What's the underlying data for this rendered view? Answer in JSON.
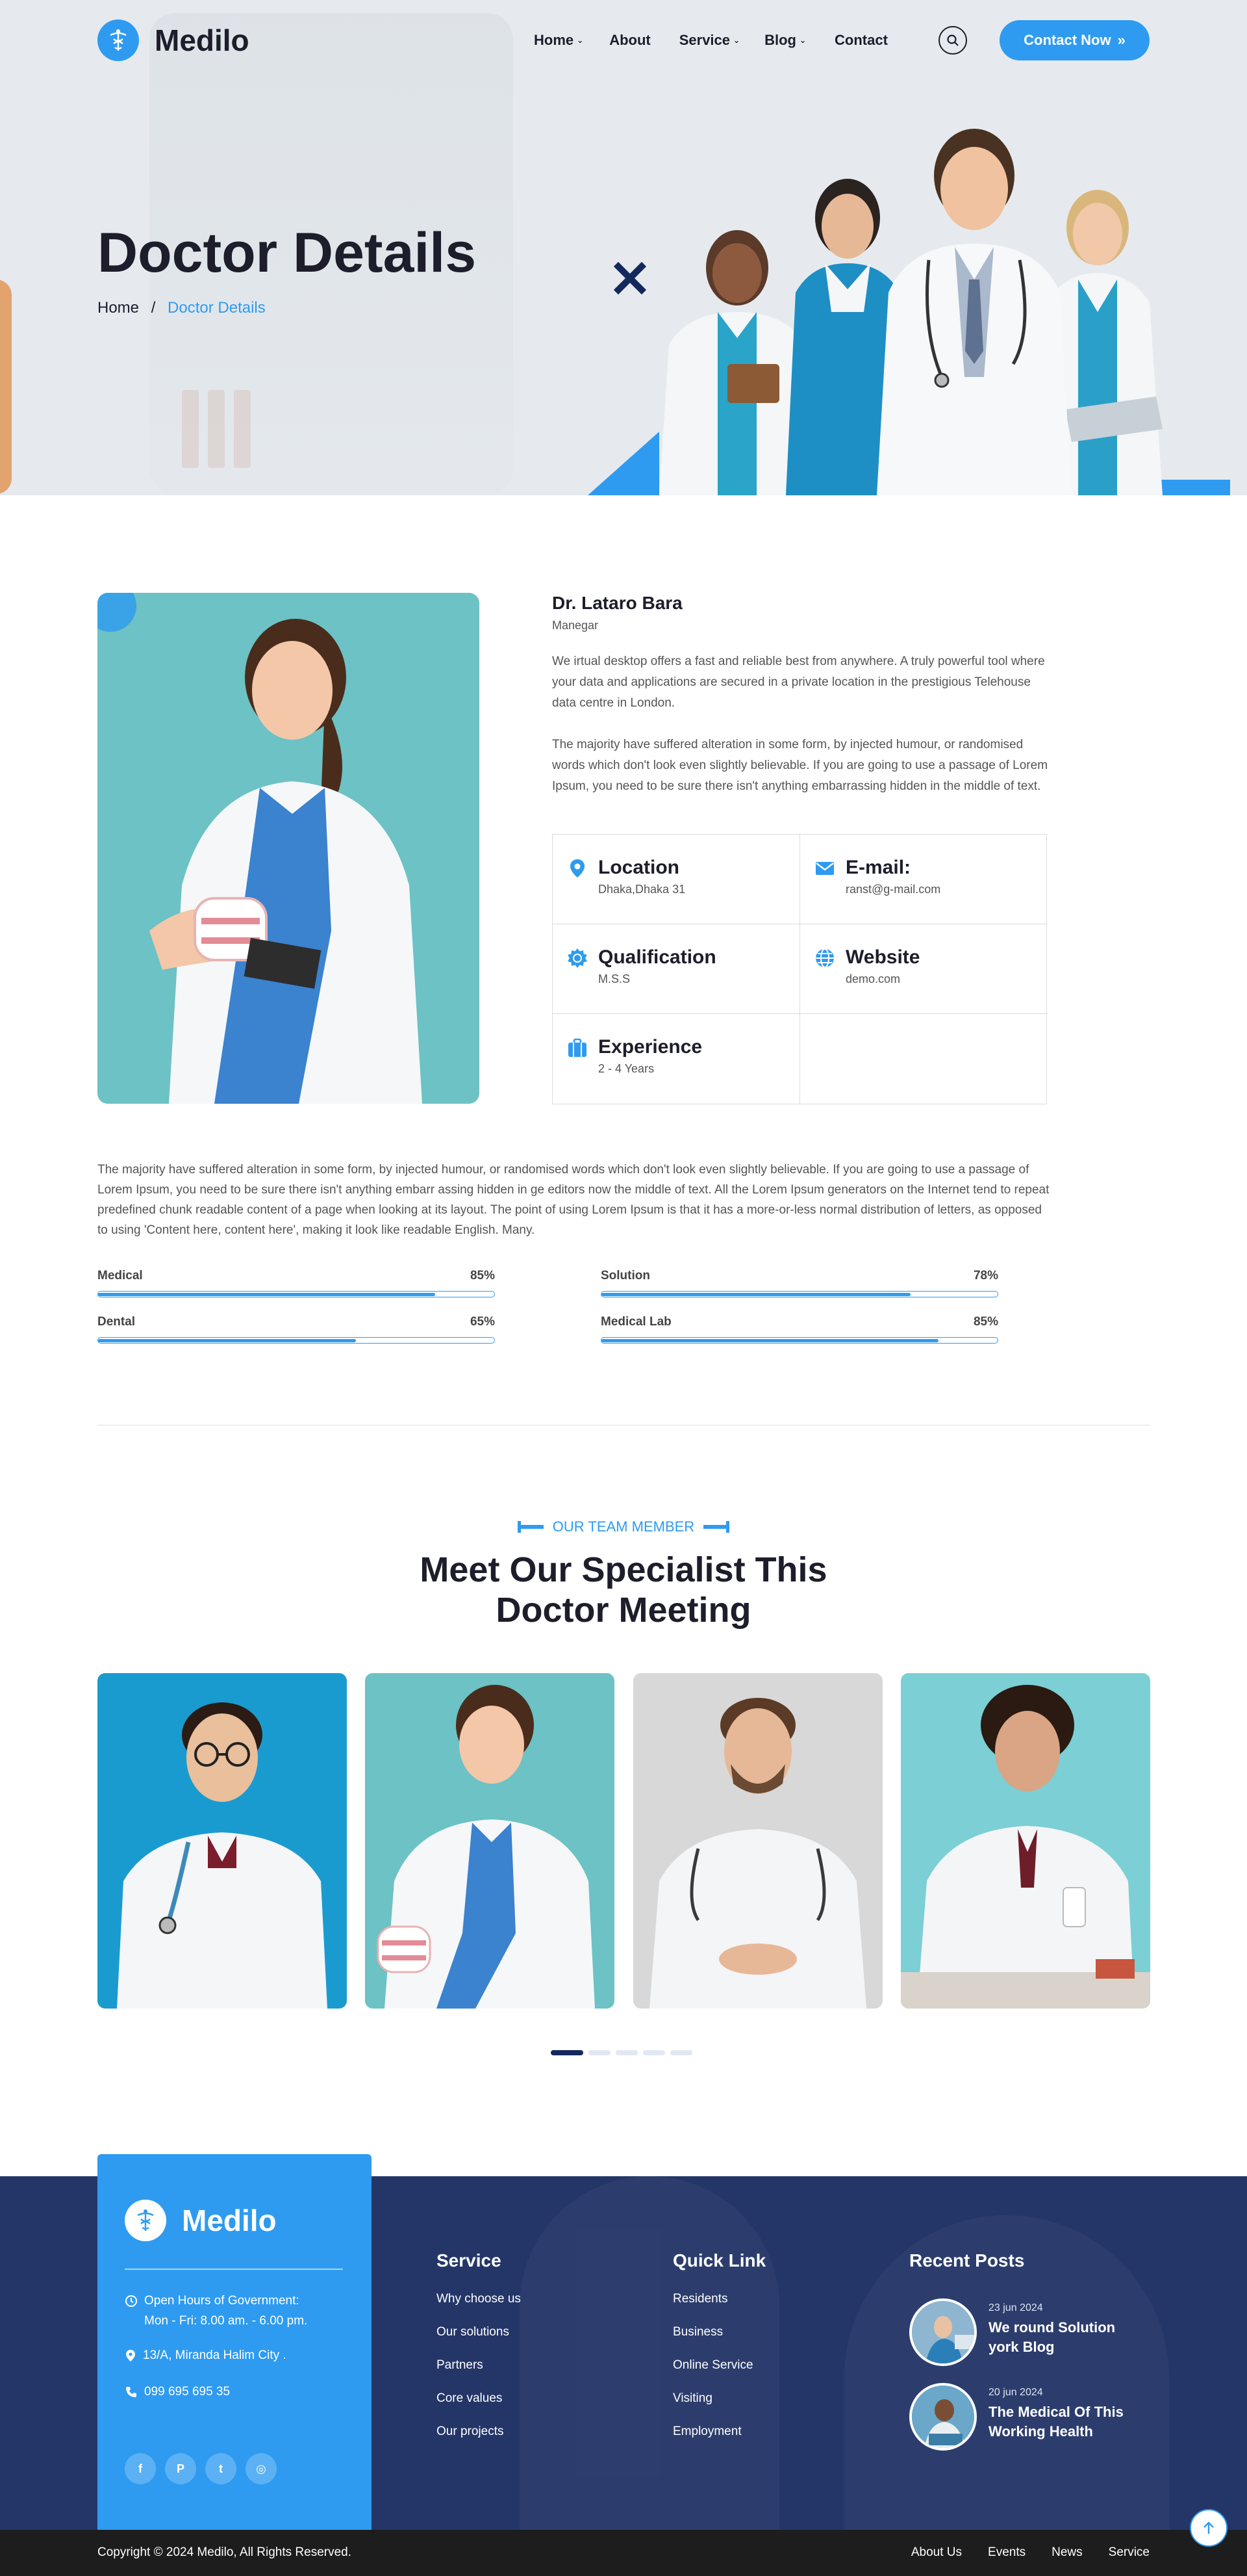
{
  "header": {
    "logo_text": "Medilo",
    "nav": [
      {
        "label": "Home",
        "has_dropdown": true
      },
      {
        "label": "About",
        "has_dropdown": false
      },
      {
        "label": "Service",
        "has_dropdown": true
      },
      {
        "label": "Blog",
        "has_dropdown": true
      },
      {
        "label": "Contact",
        "has_dropdown": false
      }
    ],
    "search_icon": "search-icon",
    "cta_label": "Contact Now"
  },
  "hero": {
    "title": "Doctor Details",
    "breadcrumb": {
      "home": "Home",
      "separator": "/",
      "current": "Doctor Details"
    }
  },
  "doctor": {
    "name": "Dr. Lataro Bara",
    "role": "Manegar",
    "paragraph_1": "We irtual desktop offers a fast and reliable best from anywhere. A truly powerful tool where your data and applications are secured in a private location in the prestigious Telehouse data centre in London.",
    "paragraph_2": "The majority have suffered alteration in some form, by injected humour, or randomised words which don't look even slightly believable. If you are going to use a passage of Lorem Ipsum, you need to be sure there isn't anything embarrassing hidden in the middle of text.",
    "info": [
      {
        "title": "Location",
        "value": "Dhaka,Dhaka 31",
        "icon": "location-pin-icon"
      },
      {
        "title": "E-mail:",
        "value": "ranst@g-mail.com",
        "icon": "envelope-icon"
      },
      {
        "title": "Qualification",
        "value": "M.S.S",
        "icon": "badge-icon"
      },
      {
        "title": "Website",
        "value": "demo.com",
        "icon": "globe-icon"
      },
      {
        "title": "Experience",
        "value": "2 - 4 Years",
        "icon": "briefcase-icon"
      }
    ],
    "description": "The majority have suffered alteration in some form, by injected humour, or randomised words which don't look even slightly believable. If you are going to use a passage of Lorem Ipsum, you need to be sure there isn't anything embarr assing hidden in ge editors now the middle of text. All the Lorem Ipsum generators on the Internet tend to repeat predefined chunk readable content of a page when looking at its layout. The point of using Lorem Ipsum is that it has a more-or-less normal distribution of letters, as opposed to using 'Content here, content here', making it look like readable English. Many.",
    "skills": [
      {
        "label": "Medical",
        "percent_label": "85%",
        "value": 0.85
      },
      {
        "label": "Solution",
        "percent_label": "78%",
        "value": 0.78
      },
      {
        "label": "Dental",
        "percent_label": "65%",
        "value": 0.65
      },
      {
        "label": "Medical Lab",
        "percent_label": "85%",
        "value": 0.85
      }
    ]
  },
  "team": {
    "subtitle": "OUR TEAM MEMBER",
    "title_line_1": "Meet Our Specialist This",
    "title_line_2": "Doctor Meeting",
    "members": [
      {
        "background": "#1a9bd0"
      },
      {
        "background": "#6cc2c4"
      },
      {
        "background": "#d8d8d8"
      },
      {
        "background": "#7ccfd4"
      }
    ],
    "slider_pages": 5,
    "active_page": 1
  },
  "footer": {
    "logo_text": "Medilo",
    "hours_line_1": "Open Hours of Government:",
    "hours_line_2": "Mon - Fri: 8.00 am. - 6.00 pm.",
    "address": "13/A, Miranda Halim City .",
    "phone": "099 695 695 35",
    "social": [
      {
        "icon": "facebook-icon",
        "glyph": "f"
      },
      {
        "icon": "pinterest-icon",
        "glyph": "P"
      },
      {
        "icon": "twitter-icon",
        "glyph": "t"
      },
      {
        "icon": "instagram-icon",
        "glyph": "◎"
      }
    ],
    "service": {
      "heading": "Service",
      "links": [
        "Why choose us",
        "Our solutions",
        "Partners",
        "Core values",
        "Our projects"
      ]
    },
    "quick_link": {
      "heading": "Quick Link",
      "links": [
        "Residents",
        "Business",
        "Online Service",
        "Visiting",
        "Employment"
      ]
    },
    "recent_posts": {
      "heading": "Recent Posts",
      "posts": [
        {
          "date": "23 jun 2024",
          "title": "We round Solution york Blog"
        },
        {
          "date": "20 jun 2024",
          "title": "The Medical Of This Working Health"
        }
      ]
    },
    "copyright": "Copyright © 2024 Medilo, All Rights Reserved.",
    "bottom_links": [
      "About Us",
      "Events",
      "News",
      "Service"
    ]
  },
  "colors": {
    "accent": "#2e9bf0",
    "dark": "#1d1d2b",
    "footer": "#243668",
    "navy": "#13285d"
  }
}
